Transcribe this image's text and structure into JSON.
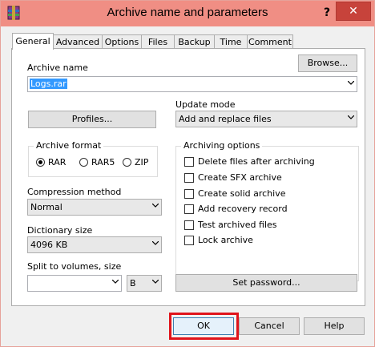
{
  "window": {
    "title": "Archive name and parameters",
    "help_button": "?",
    "close_button": "✕"
  },
  "tabs": [
    {
      "label": "General",
      "active": true
    },
    {
      "label": "Advanced"
    },
    {
      "label": "Options"
    },
    {
      "label": "Files"
    },
    {
      "label": "Backup"
    },
    {
      "label": "Time"
    },
    {
      "label": "Comment"
    }
  ],
  "general": {
    "archive_name_label": "Archive name",
    "browse_button": "Browse...",
    "archive_name_value": "Logs.rar",
    "profiles_button": "Profiles...",
    "update_mode_label": "Update mode",
    "update_mode_value": "Add and replace files",
    "archive_format": {
      "label": "Archive format",
      "options": [
        "RAR",
        "RAR5",
        "ZIP"
      ],
      "selected": "RAR"
    },
    "compression_method_label": "Compression method",
    "compression_method_value": "Normal",
    "dictionary_size_label": "Dictionary size",
    "dictionary_size_value": "4096 KB",
    "split_label": "Split to volumes, size",
    "split_value": "",
    "split_unit": "B",
    "set_password_button": "Set password...",
    "archiving_options": {
      "label": "Archiving options",
      "items": [
        {
          "label": "Delete files after archiving",
          "checked": false
        },
        {
          "label": "Create SFX archive",
          "checked": false
        },
        {
          "label": "Create solid archive",
          "checked": false
        },
        {
          "label": "Add recovery record",
          "checked": false
        },
        {
          "label": "Test archived files",
          "checked": false
        },
        {
          "label": "Lock archive",
          "checked": false
        }
      ]
    }
  },
  "footer": {
    "ok": "OK",
    "cancel": "Cancel",
    "help": "Help"
  },
  "colors": {
    "titlebar": "#f08e84",
    "close": "#c7433b",
    "highlight": "#e0141b",
    "selection": "#3399ff"
  }
}
